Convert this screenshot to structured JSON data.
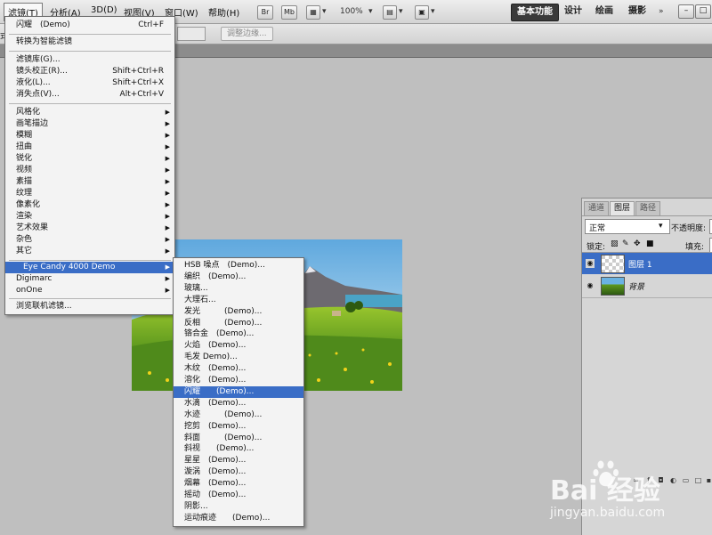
{
  "menubar": {
    "items": [
      "滤镜(T)",
      "分析(A)",
      "3D(D)",
      "视图(V)",
      "窗口(W)",
      "帮助(H)"
    ],
    "toolbar_buttons": [
      "Br",
      "Mb"
    ],
    "zoom": "100%",
    "workspaces": [
      "基本功能",
      "设计",
      "绘画",
      "摄影"
    ]
  },
  "options_bar": {
    "left_fragment": "式",
    "refine_edge": "调整边缘..."
  },
  "filter_menu": {
    "top_items": [
      {
        "label": "闪耀　(Demo)",
        "shortcut": "Ctrl+F"
      },
      {
        "label": "转换为智能滤镜",
        "shortcut": ""
      },
      {
        "label": "滤镜库(G)...",
        "shortcut": ""
      },
      {
        "label": "镜头校正(R)...",
        "shortcut": "Shift+Ctrl+R"
      },
      {
        "label": "液化(L)...",
        "shortcut": "Shift+Ctrl+X"
      },
      {
        "label": "消失点(V)...",
        "shortcut": "Alt+Ctrl+V"
      }
    ],
    "groups": [
      "风格化",
      "画笔描边",
      "模糊",
      "扭曲",
      "锐化",
      "视频",
      "素描",
      "纹理",
      "像素化",
      "渲染",
      "艺术效果",
      "杂色",
      "其它"
    ],
    "plugins": [
      "Eye Candy 4000 Demo",
      "Digimarc",
      "onOne"
    ],
    "browse_online": "浏览联机滤镜..."
  },
  "eye_candy_submenu": {
    "items": [
      "HSB 噪点　(Demo)...",
      "编织　(Demo)...",
      "玻璃...",
      "大理石...",
      "发光　　　(Demo)...",
      "反相　　　(Demo)...",
      "铬合金　(Demo)...",
      "火焰　(Demo)...",
      "毛发 Demo)...",
      "木纹　(Demo)...",
      "溶化　(Demo)...",
      "闪耀　　(Demo)...",
      "水滴　(Demo)...",
      "水迹　　　(Demo)...",
      "挖剪　(Demo)...",
      "斜面　　　(Demo)...",
      "斜视　　(Demo)...",
      "星星　(Demo)...",
      "漩涡　(Demo)...",
      "烟幕　(Demo)...",
      "摇动　(Demo)...",
      "阴影...",
      "运动痕迹　　(Demo)..."
    ],
    "highlighted_index": 11
  },
  "layers_panel": {
    "tabs": [
      "通道",
      "图层",
      "路径"
    ],
    "blend_mode": "正常",
    "opacity_label": "不透明度:",
    "lock_label": "锁定:",
    "fill_label": "填充:",
    "layers": [
      {
        "name": "图层 1",
        "selected": true
      },
      {
        "name": "背景",
        "selected": false
      }
    ]
  },
  "watermark": {
    "brand": "Bai 经验",
    "url": "jingyan.baidu.com"
  }
}
